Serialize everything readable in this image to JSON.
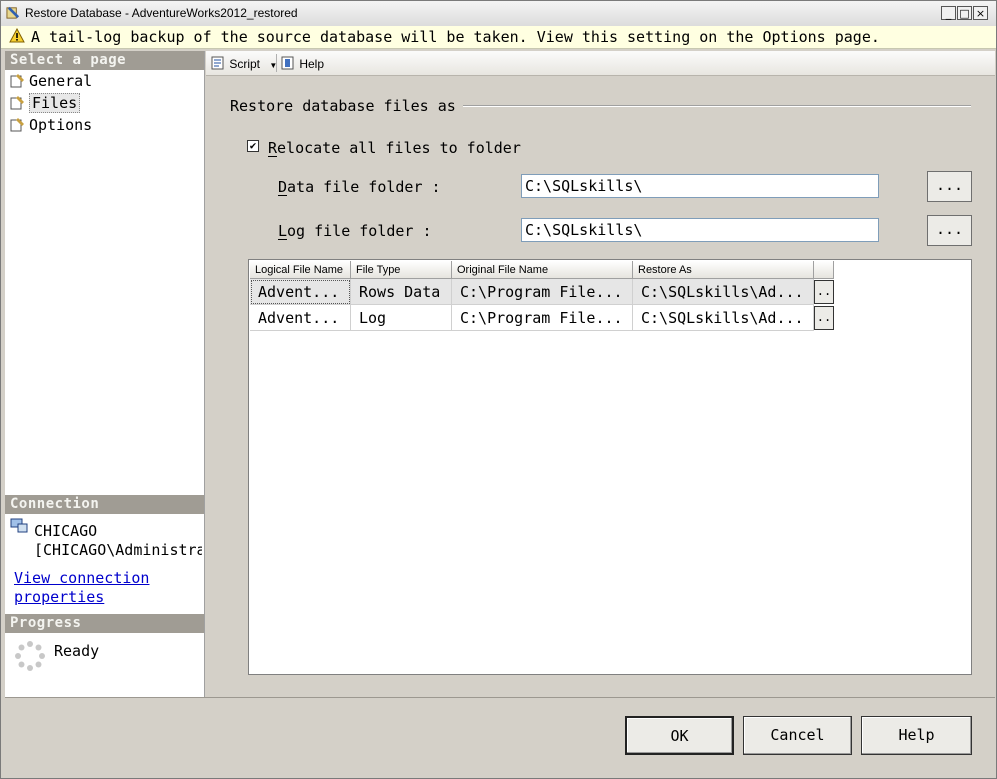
{
  "window": {
    "title": "Restore Database - AdventureWorks2012_restored"
  },
  "warning": {
    "text": "A tail-log backup of the source database will be taken. View this setting on the Options page."
  },
  "left": {
    "select_header": "Select a page",
    "pages": [
      {
        "label": "General"
      },
      {
        "label": "Files"
      },
      {
        "label": "Options"
      }
    ],
    "connection_header": "Connection",
    "server": "CHICAGO",
    "user": "[CHICAGO\\Administrator]",
    "view_link_line1": "View connection",
    "view_link_line2": "properties",
    "progress_header": "Progress",
    "progress_status": "Ready"
  },
  "toolbar": {
    "script_label": "Script",
    "help_label": "Help"
  },
  "group": {
    "title": "Restore database files as"
  },
  "relocate": {
    "checked": true,
    "label": "Relocate all files to folder"
  },
  "data_folder": {
    "label": "Data file folder :",
    "value": "C:\\SQLskills\\",
    "browse": "..."
  },
  "log_folder": {
    "label": "Log file folder :",
    "value": "C:\\SQLskills\\",
    "browse": "..."
  },
  "table": {
    "columns": [
      "Logical File Name",
      "File Type",
      "Original File Name",
      "Restore As"
    ],
    "rows": [
      [
        "Advent...",
        "Rows Data",
        "C:\\Program File...",
        "C:\\SQLskills\\Ad..."
      ],
      [
        "Advent...",
        "Log",
        "C:\\Program File...",
        "C:\\SQLskills\\Ad..."
      ]
    ],
    "cell_button": ".."
  },
  "buttons": {
    "ok": "OK",
    "cancel": "Cancel",
    "help": "Help"
  }
}
